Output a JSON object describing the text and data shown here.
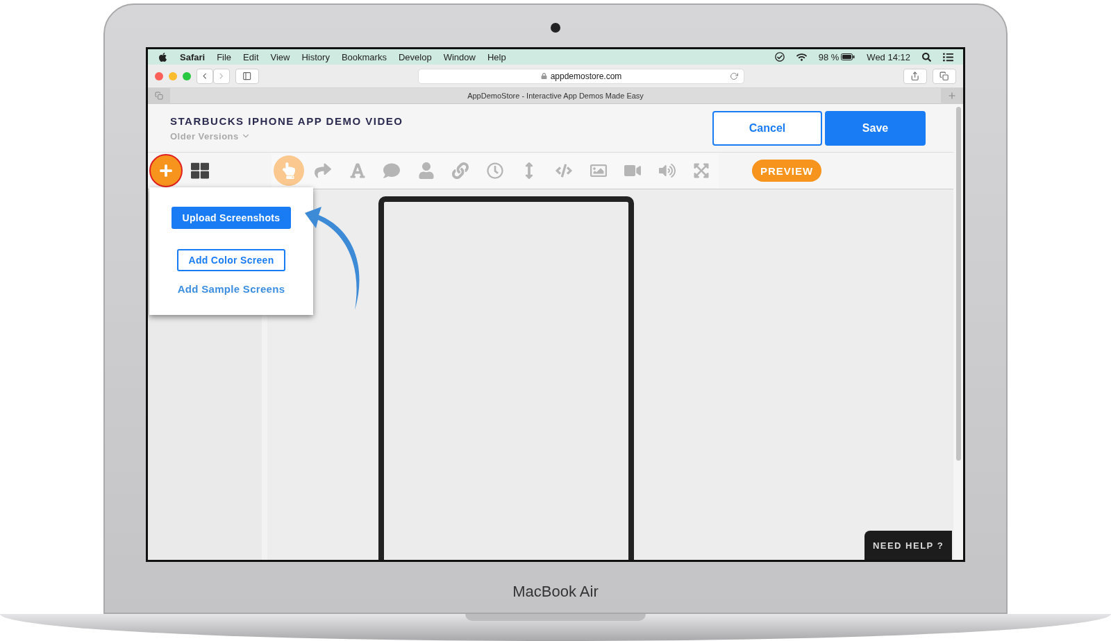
{
  "device": {
    "label": "MacBook Air"
  },
  "menu_bar": {
    "app_name": "Safari",
    "menus": [
      "File",
      "Edit",
      "View",
      "History",
      "Bookmarks",
      "Develop",
      "Window",
      "Help"
    ],
    "battery": "98 %",
    "clock": "Wed 14:12"
  },
  "browser": {
    "url": "appdemostore.com",
    "tab_title": "AppDemoStore - Interactive App Demos Made Easy"
  },
  "header": {
    "title": "STARBUCKS IPHONE APP DEMO VIDEO",
    "versions": "Older Versions",
    "buttons": [
      {
        "kind": "outline",
        "label": "Cancel"
      },
      {
        "kind": "primary",
        "label": "Save"
      }
    ]
  },
  "toolbar": {
    "add_expanded": true,
    "tools": [
      {
        "selected": true
      },
      {
        "selected": false
      },
      {
        "selected": false
      },
      {
        "selected": false
      },
      {
        "selected": false
      },
      {
        "selected": false
      },
      {
        "selected": false
      },
      {
        "selected": false
      },
      {
        "selected": false
      },
      {
        "selected": false
      },
      {
        "selected": false
      },
      {
        "selected": false
      },
      {
        "selected": false
      }
    ],
    "preview": "PREVIEW"
  },
  "add_menu": {
    "items": [
      {
        "kind": "primary",
        "label": "Upload Screenshots"
      },
      {
        "kind": "outline",
        "label": "Add Color Screen"
      },
      {
        "kind": "link",
        "label": "Add Sample Screens"
      }
    ]
  },
  "help": "NEED HELP ?"
}
